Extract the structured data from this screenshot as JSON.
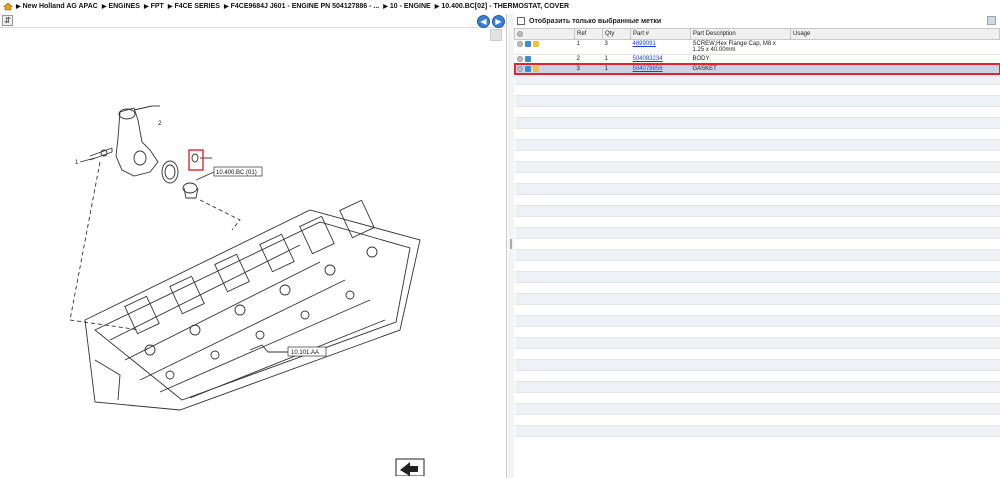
{
  "breadcrumb": {
    "items": [
      "New Holland AG APAC",
      "ENGINES",
      "FPT",
      "F4CE SERIES",
      "F4CE9684J J601 - ENGINE PN 504127886 - ...",
      "10 - ENGINE",
      "10.400.BC[02] - THERMOSTAT, COVER"
    ]
  },
  "diagram": {
    "callouts": [
      "1",
      "2",
      "10.400.BC (01)",
      "10.101.AA"
    ]
  },
  "parts_panel": {
    "filter_label": "Отобразить только выбранные метки",
    "columns": [
      "Ref",
      "Qty",
      "Part #",
      "Part Description",
      "Usage"
    ],
    "rows": [
      {
        "ref": "1",
        "qty": "3",
        "part": "4899091",
        "desc": "SCREW,Hex Flange Cap, M8 x 1.25 x 40.00mm",
        "usage": ""
      },
      {
        "ref": "2",
        "qty": "1",
        "part": "504083234",
        "desc": "BODY",
        "usage": ""
      },
      {
        "ref": "3",
        "qty": "1",
        "part": "504078856",
        "desc": "GASKET",
        "usage": ""
      }
    ]
  },
  "colors": {
    "selection_border": "#e0262b",
    "link": "#1a3fd6",
    "nav_button": "#3b7fd4"
  }
}
